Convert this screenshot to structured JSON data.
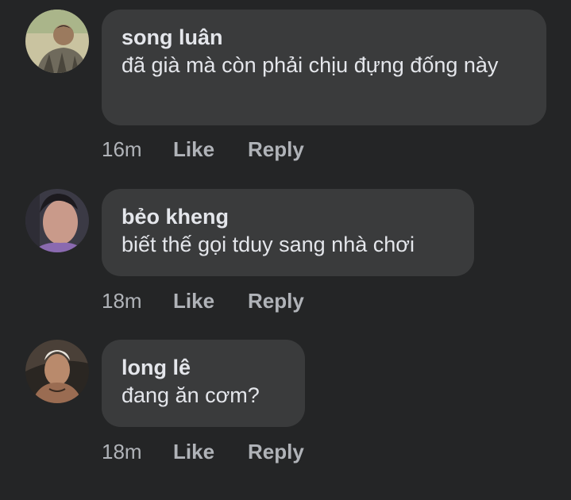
{
  "comments": [
    {
      "author": "song luân",
      "text": "đã già mà còn phải chịu đựng đống này",
      "time": "16m",
      "like_label": "Like",
      "reply_label": "Reply",
      "avatar_icon": "profile-photo-icon"
    },
    {
      "author": "bẻo kheng",
      "text": "biết thế gọi tduy sang nhà chơi",
      "time": "18m",
      "like_label": "Like",
      "reply_label": "Reply",
      "avatar_icon": "profile-photo-icon"
    },
    {
      "author": "long lê",
      "text": "đang ăn cơm?",
      "time": "18m",
      "like_label": "Like",
      "reply_label": "Reply",
      "avatar_icon": "profile-photo-icon"
    }
  ],
  "colors": {
    "background": "#242526",
    "bubble": "#3a3b3c",
    "primary_text": "#e4e6eb",
    "secondary_text": "#b0b3b8"
  }
}
